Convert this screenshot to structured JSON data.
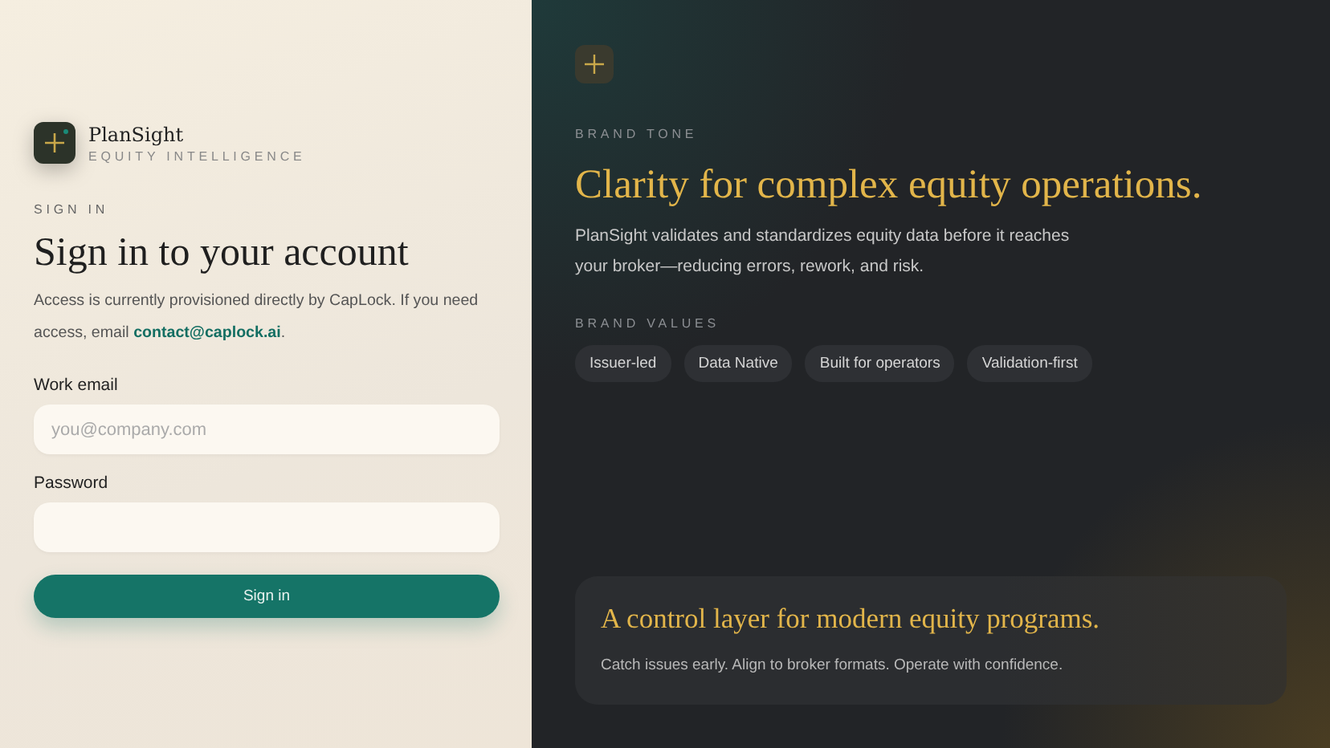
{
  "brand": {
    "name": "PlanSight",
    "tagline": "EQUITY INTELLIGENCE"
  },
  "signin": {
    "eyebrow": "SIGN IN",
    "title": "Sign in to your account",
    "intro": {
      "text": "Access is currently provisioned directly by CapLock. If you need access, email ",
      "link": "contact@caplock.ai",
      "end": "."
    },
    "fields": [
      {
        "label": "Work email",
        "placeholder": "you@company.com"
      },
      {
        "label": "Password"
      }
    ],
    "button": "Sign in"
  },
  "panel": {
    "eyebrow": "BRAND TONE",
    "headline": "Clarity for complex equity operations.",
    "description": "PlanSight validates and standardizes equity data before it reaches your broker—reducing errors, rework, and risk.",
    "values_label": "BRAND VALUES",
    "values": [
      "Issuer-led",
      "Data Native",
      "Built for operators",
      "Validation-first"
    ],
    "card": {
      "title": "A control layer for modern equity programs.",
      "text": "Catch issues early. Align to broker formats. Operate with confidence."
    }
  }
}
